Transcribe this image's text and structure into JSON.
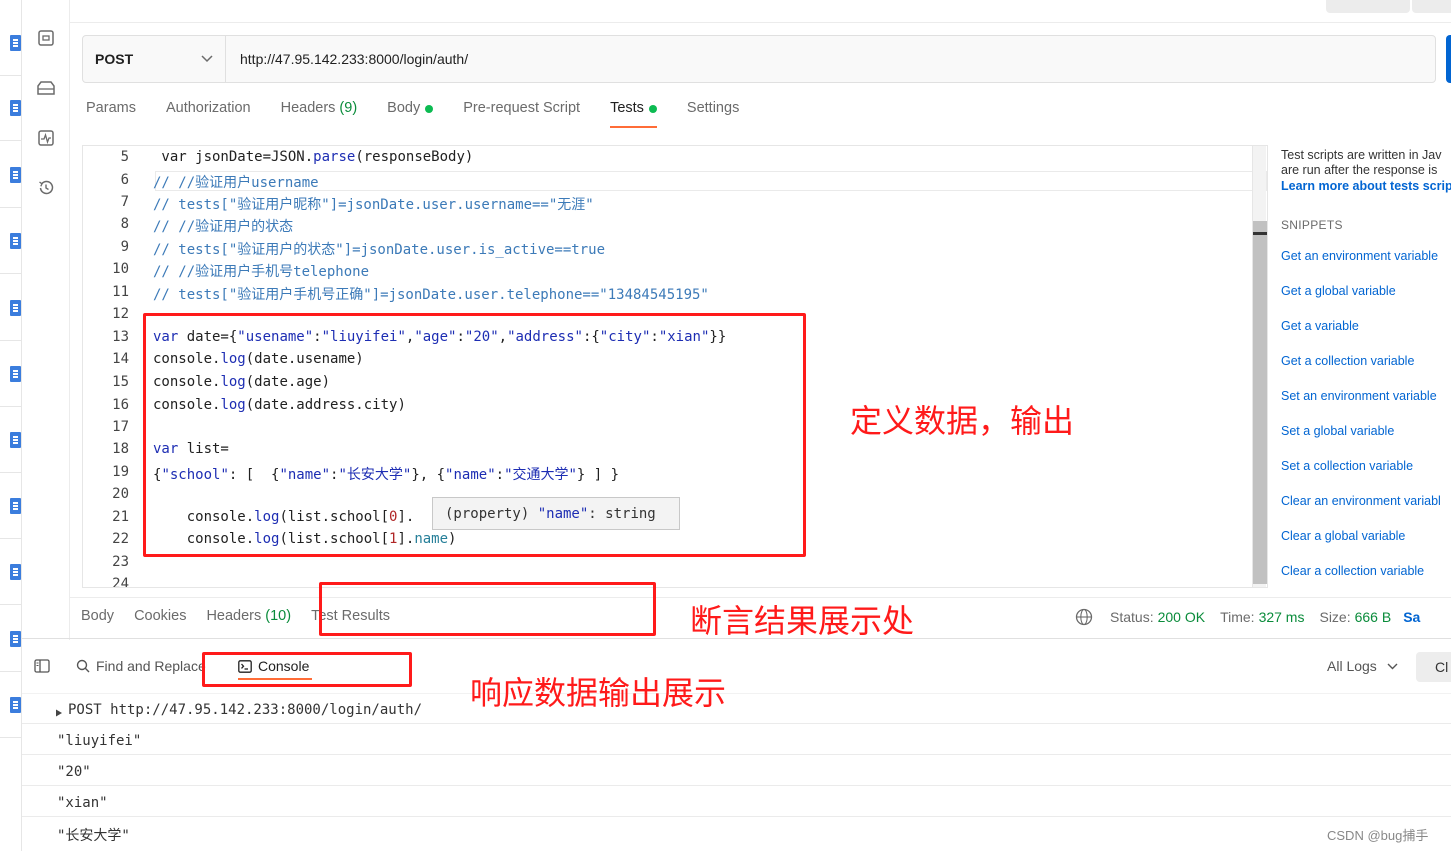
{
  "request": {
    "method": "POST",
    "url": "http://47.95.142.233:8000/login/auth/"
  },
  "request_tabs": [
    {
      "label": "Params",
      "count": "",
      "dot": false,
      "active": false
    },
    {
      "label": "Authorization",
      "count": "",
      "dot": false,
      "active": false
    },
    {
      "label": "Headers",
      "count": "(9)",
      "dot": false,
      "active": false
    },
    {
      "label": "Body",
      "count": "",
      "dot": true,
      "active": false
    },
    {
      "label": "Pre-request Script",
      "count": "",
      "dot": false,
      "active": false
    },
    {
      "label": "Tests",
      "count": "",
      "dot": true,
      "active": true
    },
    {
      "label": "Settings",
      "count": "",
      "dot": false,
      "active": false
    }
  ],
  "editor": {
    "line_numbers": [
      "5",
      "6",
      "7",
      "8",
      "9",
      "10",
      "11",
      "12",
      "13",
      "14",
      "15",
      "16",
      "17",
      "18",
      "19",
      "20",
      "21",
      "22",
      "23",
      "24"
    ],
    "tooltip": "(property) \"name\": string"
  },
  "right_panel": {
    "desc_line1": "Test scripts are written in Jav",
    "desc_line2": "are run after the response is",
    "learn_more": "Learn more about tests scrip",
    "snippets_heading": "SNIPPETS",
    "snippets": [
      "Get an environment variable",
      "Get a global variable",
      "Get a variable",
      "Get a collection variable",
      "Set an environment variable",
      "Set a global variable",
      "Set a collection variable",
      "Clear an environment variabl",
      "Clear a global variable",
      "Clear a collection variable"
    ]
  },
  "response_tabs": [
    {
      "label": "Body",
      "count": ""
    },
    {
      "label": "Cookies",
      "count": ""
    },
    {
      "label": "Headers",
      "count": "(10)"
    },
    {
      "label": "Test Results",
      "count": ""
    }
  ],
  "status": {
    "status_label": "Status:",
    "status_value": "200 OK",
    "time_label": "Time:",
    "time_value": "327 ms",
    "size_label": "Size:",
    "size_value": "666 B",
    "save_label": "Sa"
  },
  "console_toolbar": {
    "find_replace": "Find and Replace",
    "console": "Console",
    "all_logs": "All Logs",
    "clear": "Cl"
  },
  "console_logs": [
    "POST http://47.95.142.233:8000/login/auth/",
    "\"liuyifei\"",
    "\"20\"",
    "\"xian\"",
    "\"长安大学\""
  ],
  "annotations": {
    "define_data": "定义数据，输出",
    "assertion_result": "断言结果展示处",
    "response_output": "响应数据输出展示"
  },
  "watermark": "CSDN @bug捕手"
}
